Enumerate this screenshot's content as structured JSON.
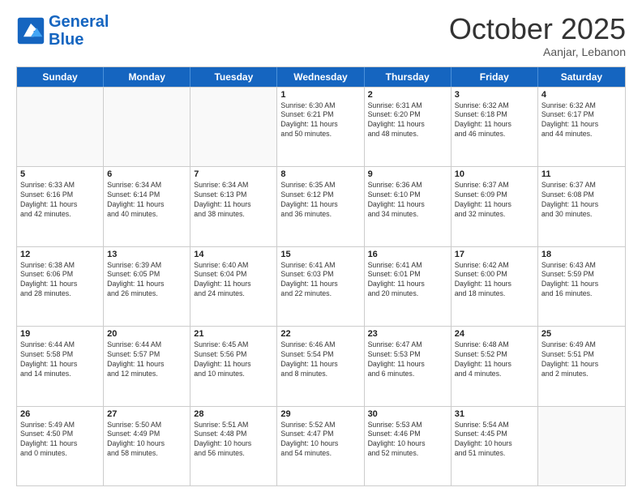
{
  "header": {
    "logo_line1": "General",
    "logo_line2": "Blue",
    "month": "October 2025",
    "location": "Aanjar, Lebanon"
  },
  "days_of_week": [
    "Sunday",
    "Monday",
    "Tuesday",
    "Wednesday",
    "Thursday",
    "Friday",
    "Saturday"
  ],
  "weeks": [
    [
      {
        "day": "",
        "info": ""
      },
      {
        "day": "",
        "info": ""
      },
      {
        "day": "",
        "info": ""
      },
      {
        "day": "1",
        "info": "Sunrise: 6:30 AM\nSunset: 6:21 PM\nDaylight: 11 hours\nand 50 minutes."
      },
      {
        "day": "2",
        "info": "Sunrise: 6:31 AM\nSunset: 6:20 PM\nDaylight: 11 hours\nand 48 minutes."
      },
      {
        "day": "3",
        "info": "Sunrise: 6:32 AM\nSunset: 6:18 PM\nDaylight: 11 hours\nand 46 minutes."
      },
      {
        "day": "4",
        "info": "Sunrise: 6:32 AM\nSunset: 6:17 PM\nDaylight: 11 hours\nand 44 minutes."
      }
    ],
    [
      {
        "day": "5",
        "info": "Sunrise: 6:33 AM\nSunset: 6:16 PM\nDaylight: 11 hours\nand 42 minutes."
      },
      {
        "day": "6",
        "info": "Sunrise: 6:34 AM\nSunset: 6:14 PM\nDaylight: 11 hours\nand 40 minutes."
      },
      {
        "day": "7",
        "info": "Sunrise: 6:34 AM\nSunset: 6:13 PM\nDaylight: 11 hours\nand 38 minutes."
      },
      {
        "day": "8",
        "info": "Sunrise: 6:35 AM\nSunset: 6:12 PM\nDaylight: 11 hours\nand 36 minutes."
      },
      {
        "day": "9",
        "info": "Sunrise: 6:36 AM\nSunset: 6:10 PM\nDaylight: 11 hours\nand 34 minutes."
      },
      {
        "day": "10",
        "info": "Sunrise: 6:37 AM\nSunset: 6:09 PM\nDaylight: 11 hours\nand 32 minutes."
      },
      {
        "day": "11",
        "info": "Sunrise: 6:37 AM\nSunset: 6:08 PM\nDaylight: 11 hours\nand 30 minutes."
      }
    ],
    [
      {
        "day": "12",
        "info": "Sunrise: 6:38 AM\nSunset: 6:06 PM\nDaylight: 11 hours\nand 28 minutes."
      },
      {
        "day": "13",
        "info": "Sunrise: 6:39 AM\nSunset: 6:05 PM\nDaylight: 11 hours\nand 26 minutes."
      },
      {
        "day": "14",
        "info": "Sunrise: 6:40 AM\nSunset: 6:04 PM\nDaylight: 11 hours\nand 24 minutes."
      },
      {
        "day": "15",
        "info": "Sunrise: 6:41 AM\nSunset: 6:03 PM\nDaylight: 11 hours\nand 22 minutes."
      },
      {
        "day": "16",
        "info": "Sunrise: 6:41 AM\nSunset: 6:01 PM\nDaylight: 11 hours\nand 20 minutes."
      },
      {
        "day": "17",
        "info": "Sunrise: 6:42 AM\nSunset: 6:00 PM\nDaylight: 11 hours\nand 18 minutes."
      },
      {
        "day": "18",
        "info": "Sunrise: 6:43 AM\nSunset: 5:59 PM\nDaylight: 11 hours\nand 16 minutes."
      }
    ],
    [
      {
        "day": "19",
        "info": "Sunrise: 6:44 AM\nSunset: 5:58 PM\nDaylight: 11 hours\nand 14 minutes."
      },
      {
        "day": "20",
        "info": "Sunrise: 6:44 AM\nSunset: 5:57 PM\nDaylight: 11 hours\nand 12 minutes."
      },
      {
        "day": "21",
        "info": "Sunrise: 6:45 AM\nSunset: 5:56 PM\nDaylight: 11 hours\nand 10 minutes."
      },
      {
        "day": "22",
        "info": "Sunrise: 6:46 AM\nSunset: 5:54 PM\nDaylight: 11 hours\nand 8 minutes."
      },
      {
        "day": "23",
        "info": "Sunrise: 6:47 AM\nSunset: 5:53 PM\nDaylight: 11 hours\nand 6 minutes."
      },
      {
        "day": "24",
        "info": "Sunrise: 6:48 AM\nSunset: 5:52 PM\nDaylight: 11 hours\nand 4 minutes."
      },
      {
        "day": "25",
        "info": "Sunrise: 6:49 AM\nSunset: 5:51 PM\nDaylight: 11 hours\nand 2 minutes."
      }
    ],
    [
      {
        "day": "26",
        "info": "Sunrise: 5:49 AM\nSunset: 4:50 PM\nDaylight: 11 hours\nand 0 minutes."
      },
      {
        "day": "27",
        "info": "Sunrise: 5:50 AM\nSunset: 4:49 PM\nDaylight: 10 hours\nand 58 minutes."
      },
      {
        "day": "28",
        "info": "Sunrise: 5:51 AM\nSunset: 4:48 PM\nDaylight: 10 hours\nand 56 minutes."
      },
      {
        "day": "29",
        "info": "Sunrise: 5:52 AM\nSunset: 4:47 PM\nDaylight: 10 hours\nand 54 minutes."
      },
      {
        "day": "30",
        "info": "Sunrise: 5:53 AM\nSunset: 4:46 PM\nDaylight: 10 hours\nand 52 minutes."
      },
      {
        "day": "31",
        "info": "Sunrise: 5:54 AM\nSunset: 4:45 PM\nDaylight: 10 hours\nand 51 minutes."
      },
      {
        "day": "",
        "info": ""
      }
    ]
  ]
}
